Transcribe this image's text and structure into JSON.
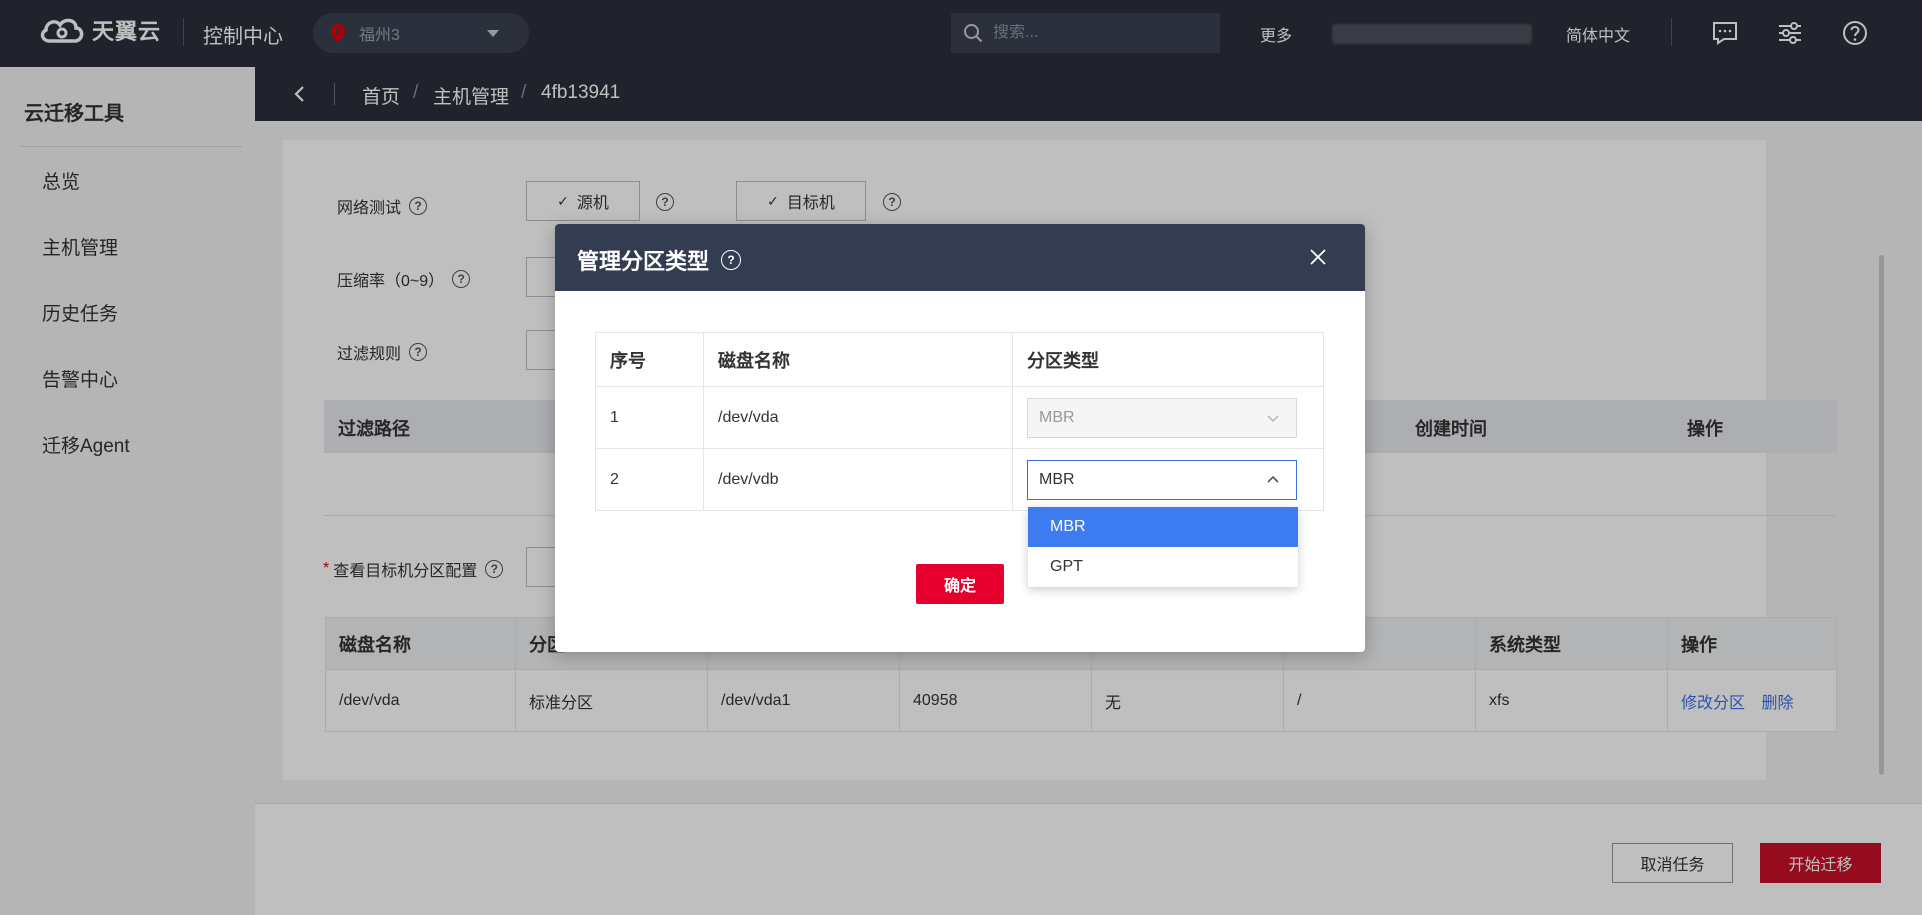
{
  "topbar": {
    "brand": "天翼云",
    "console": "控制中心",
    "region": "福州3",
    "search_placeholder": "搜索...",
    "more": "更多",
    "language": "简体中文"
  },
  "sidebar": {
    "title": "云迁移工具",
    "items": [
      {
        "label": "总览"
      },
      {
        "label": "主机管理"
      },
      {
        "label": "历史任务"
      },
      {
        "label": "告警中心"
      },
      {
        "label": "迁移Agent"
      }
    ]
  },
  "breadcrumb": {
    "home": "首页",
    "section": "主机管理",
    "current": "4fb13941",
    "separator": "/"
  },
  "form": {
    "network_test_label": "网络测试",
    "source_btn": "源机",
    "target_btn": "目标机",
    "compression_label": "压缩率（0~9）",
    "filter_label": "过滤规则",
    "filter_table_headers": {
      "path": "过滤路径",
      "created": "创建时间",
      "action": "操作"
    },
    "partition_config_label": "查看目标机分区配置"
  },
  "partition_table": {
    "headers": [
      "磁盘名称",
      "分区",
      "",
      "",
      "",
      "",
      "系统类型",
      "操作"
    ],
    "visible_headers": {
      "disk": "磁盘名称",
      "part_prefix": "分区",
      "fs_type": "系统类型",
      "action": "操作"
    },
    "rows": [
      {
        "disk": "/dev/vda",
        "type": "标准分区",
        "partition": "/dev/vda1",
        "size": "40958",
        "lvm": "无",
        "mount": "/",
        "fs": "xfs",
        "edit": "修改分区",
        "delete": "删除"
      }
    ]
  },
  "footer": {
    "cancel": "取消任务",
    "start": "开始迁移"
  },
  "modal": {
    "title": "管理分区类型",
    "headers": {
      "index": "序号",
      "disk": "磁盘名称",
      "ptype": "分区类型"
    },
    "rows": [
      {
        "index": "1",
        "disk": "/dev/vda",
        "ptype": "MBR",
        "disabled": true
      },
      {
        "index": "2",
        "disk": "/dev/vdb",
        "ptype": "MBR",
        "disabled": false
      }
    ],
    "dropdown_options": [
      "MBR",
      "GPT"
    ],
    "selected_option": "MBR",
    "ok": "确定"
  },
  "colors": {
    "topbar_bg": "#2b2f3a",
    "modal_header": "#343c52",
    "primary_red": "#e6002d",
    "start_red": "#c7102a",
    "link_blue": "#3d6ee3",
    "dropdown_selected": "#3d7bf0"
  },
  "icons": {
    "logo": "cloud-logo-icon",
    "region": "location-pin-icon",
    "search": "search-icon",
    "message": "message-icon",
    "settings": "sliders-icon",
    "help": "help-icon",
    "back": "chevron-left-icon",
    "close": "close-icon"
  }
}
